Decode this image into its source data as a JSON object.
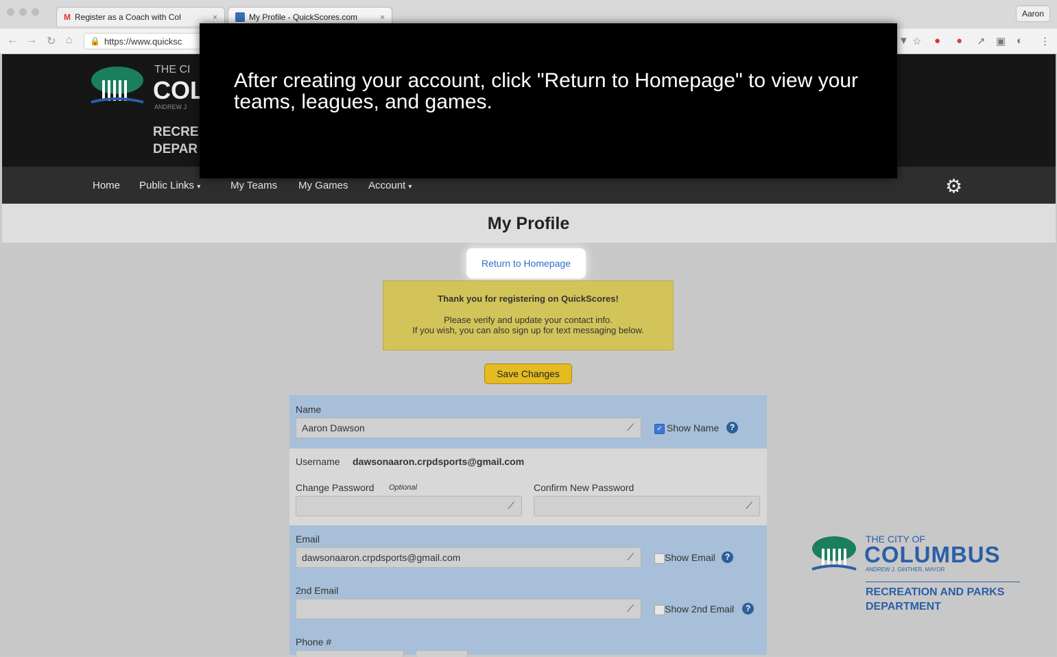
{
  "browser": {
    "tabs": [
      {
        "label": "Register as a Coach with Col",
        "favicon": "gmail-icon"
      },
      {
        "label": "My Profile - QuickScores.com",
        "favicon": "quickscores-icon"
      }
    ],
    "profile_name": "Aaron",
    "url": "https://www.quicksc"
  },
  "header": {
    "logo_line1": "THE CI",
    "logo_line2": "COL",
    "logo_line3": "ANDREW J",
    "logo_line4": "RECRE",
    "logo_line5": "DEPAR"
  },
  "nav": {
    "items": [
      "Home",
      "Public Links",
      "My Teams",
      "My Games",
      "Account"
    ]
  },
  "page": {
    "title": "My Profile",
    "return_link": "Return to Homepage",
    "notice_title": "Thank you for registering on QuickScores!",
    "notice_line1": "Please verify and update your contact info.",
    "notice_line2": "If you wish, you can also sign up for text messaging below.",
    "save_button": "Save Changes"
  },
  "form": {
    "name_label": "Name",
    "name_value": "Aaron Dawson",
    "show_name_label": "Show Name",
    "show_name_checked": true,
    "username_label": "Username",
    "username_value": "dawsonaaron.crpdsports@gmail.com",
    "change_password_label": "Change Password",
    "optional_label": "Optional",
    "confirm_password_label": "Confirm New Password",
    "email_label": "Email",
    "email_value": "dawsonaaron.crpdsports@gmail.com",
    "show_email_label": "Show Email",
    "email2_label": "2nd Email",
    "show_email2_label": "Show 2nd Email",
    "phone_label": "Phone #"
  },
  "logo_right": {
    "line1": "THE CITY OF",
    "line2": "COLUMBUS",
    "line3": "ANDREW J. GINTHER, MAYOR",
    "line4": "RECREATION AND PARKS",
    "line5": "DEPARTMENT"
  },
  "overlay": {
    "text": "After creating your account, click \"Return to Homepage\" to view your teams, leagues, and games."
  },
  "colors": {
    "accent_blue": "#2a6fd0",
    "save_yellow": "#e5bb22",
    "logo_green": "#1a7f5a",
    "logo_blue": "#2a5ea8"
  }
}
